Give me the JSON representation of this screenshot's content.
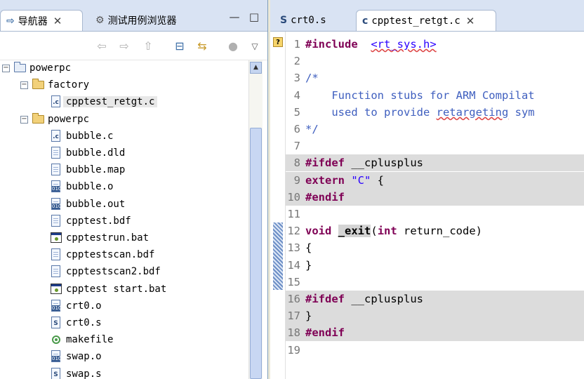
{
  "left_panel": {
    "tabs": [
      {
        "label": "导航器",
        "close": "✕"
      },
      {
        "label": "测试用例浏览器"
      }
    ],
    "window_buttons": {
      "minimize": "—",
      "maximize": "□"
    },
    "toolbar_icons": [
      "back-icon",
      "forward-icon",
      "up-icon",
      "collapse-all-icon",
      "link-with-editor-icon",
      "filters-icon",
      "view-menu-icon"
    ],
    "tree": [
      {
        "label": "powerpc",
        "type": "project",
        "depth": 0,
        "expanded": true
      },
      {
        "label": "factory",
        "type": "folder",
        "depth": 1,
        "expanded": true
      },
      {
        "label": "cpptest_retgt.c",
        "type": "c-file",
        "depth": 2,
        "selected": true
      },
      {
        "label": "powerpc",
        "type": "folder",
        "depth": 1,
        "expanded": true
      },
      {
        "label": "bubble.c",
        "type": "c-file",
        "depth": 2
      },
      {
        "label": "bubble.dld",
        "type": "text-file",
        "depth": 2
      },
      {
        "label": "bubble.map",
        "type": "text-file",
        "depth": 2
      },
      {
        "label": "bubble.o",
        "type": "binary-file",
        "depth": 2
      },
      {
        "label": "bubble.out",
        "type": "binary-file",
        "depth": 2
      },
      {
        "label": "cpptest.bdf",
        "type": "text-file",
        "depth": 2
      },
      {
        "label": "cpptestrun.bat",
        "type": "bat-file",
        "depth": 2
      },
      {
        "label": "cpptestscan.bdf",
        "type": "text-file",
        "depth": 2
      },
      {
        "label": "cpptestscan2.bdf",
        "type": "text-file",
        "depth": 2
      },
      {
        "label": "cpptest start.bat",
        "type": "bat-file",
        "depth": 2
      },
      {
        "label": "crt0.o",
        "type": "binary-file",
        "depth": 2
      },
      {
        "label": "crt0.s",
        "type": "s-file",
        "depth": 2
      },
      {
        "label": "makefile",
        "type": "make-file",
        "depth": 2
      },
      {
        "label": "swap.o",
        "type": "binary-file",
        "depth": 2
      },
      {
        "label": "swap.s",
        "type": "s-file",
        "depth": 2
      }
    ]
  },
  "editor": {
    "tabs": [
      {
        "label": "crt0.s",
        "icon": "S"
      },
      {
        "label": "cpptest_retgt.c",
        "icon": "c",
        "close": "✕",
        "active": true
      }
    ],
    "lines": [
      {
        "n": "1",
        "parts": [
          [
            "kw",
            "#include"
          ],
          [
            "",
            "  "
          ],
          [
            "str squig",
            "<rt_sys.h>"
          ]
        ]
      },
      {
        "n": "2",
        "parts": []
      },
      {
        "n": "3",
        "parts": [
          [
            "cm",
            "/*"
          ]
        ]
      },
      {
        "n": "4",
        "parts": [
          [
            "cm",
            "    Function stubs for ARM Compilat"
          ]
        ]
      },
      {
        "n": "5",
        "parts": [
          [
            "cm",
            "    used to provide "
          ],
          [
            "cm squig",
            "retargeting"
          ],
          [
            "cm",
            " sym"
          ]
        ]
      },
      {
        "n": "6",
        "parts": [
          [
            "cm",
            "*/"
          ]
        ]
      },
      {
        "n": "7",
        "parts": []
      },
      {
        "n": "8",
        "hl": true,
        "parts": [
          [
            "kw",
            "#ifdef"
          ],
          [
            "",
            " __cplusplus"
          ]
        ]
      },
      {
        "n": "9",
        "hl": true,
        "parts": [
          [
            "kw",
            "extern"
          ],
          [
            "",
            " "
          ],
          [
            "str",
            "\"C\""
          ],
          [
            "",
            " {"
          ]
        ]
      },
      {
        "n": "10",
        "hl": true,
        "parts": [
          [
            "kw",
            "#endif"
          ]
        ]
      },
      {
        "n": "11",
        "parts": []
      },
      {
        "n": "12",
        "parts": [
          [
            "kw",
            "void"
          ],
          [
            "",
            " "
          ],
          [
            "bold boxed",
            "_exit"
          ],
          [
            "",
            "("
          ],
          [
            "kw",
            "int"
          ],
          [
            "",
            " return_code)"
          ]
        ]
      },
      {
        "n": "13",
        "parts": [
          [
            "",
            "{"
          ]
        ]
      },
      {
        "n": "14",
        "parts": [
          [
            "",
            "}"
          ]
        ]
      },
      {
        "n": "15",
        "parts": []
      },
      {
        "n": "16",
        "hl": true,
        "parts": [
          [
            "kw",
            "#ifdef"
          ],
          [
            "",
            " __cplusplus"
          ]
        ]
      },
      {
        "n": "17",
        "hl": true,
        "parts": [
          [
            "",
            "}"
          ]
        ]
      },
      {
        "n": "18",
        "hl": true,
        "parts": [
          [
            "kw",
            "#endif"
          ]
        ]
      },
      {
        "n": "19",
        "parts": []
      }
    ]
  }
}
